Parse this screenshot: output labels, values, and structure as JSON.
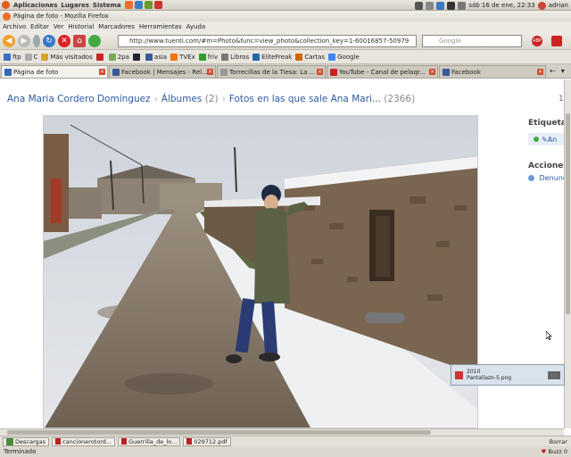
{
  "panel": {
    "menus": [
      "Aplicaciones",
      "Lugares",
      "Sistema"
    ],
    "clock": "sáb 16 de ene, 22:33",
    "user": "adrian"
  },
  "window": {
    "title": "Página de foto - Mozilla Firefox"
  },
  "menubar": [
    "Archivo",
    "Editar",
    "Ver",
    "Historial",
    "Marcadores",
    "Herramientas",
    "Ayuda"
  ],
  "navbar": {
    "url": "http://www.tuenti.com/#m=Photo&func=view_photo&collection_key=1-60016857-50979",
    "search_placeholder": "Google"
  },
  "bookmarks": [
    "ftp",
    "C",
    "Más visitados",
    "2pa",
    "asia",
    "TVEx",
    "friv",
    "Libros",
    "EliteFreak",
    "Cartas",
    "Google"
  ],
  "tabs": [
    {
      "label": "Página de foto"
    },
    {
      "label": "Facebook | Mensajes - Rel..."
    },
    {
      "label": "Torrecillas de la Tiesa: La ..."
    },
    {
      "label": "YouTube - Canal de pelaqr..."
    },
    {
      "label": "Facebook"
    }
  ],
  "page": {
    "breadcrumb": {
      "owner": "Ana Maria Cordero Domínguez",
      "albums": "Álbumes",
      "albums_count": "(2)",
      "current": "Fotos en las que sale Ana Mari...",
      "current_count": "(2366)"
    },
    "page_number": "1",
    "side": {
      "etiquetas": "Etiqueta",
      "tag": "An",
      "acciones": "Acciones",
      "denunciar": "Denunc"
    }
  },
  "download_popup": {
    "year": "2010",
    "filename": "Pantallazo-5.png"
  },
  "downloads": {
    "label": "Descargas",
    "items": [
      "cancionerotord...",
      "Guerrilla_de_lo...",
      "029712.pdf"
    ],
    "clear": "Borrar"
  },
  "status": {
    "text": "Terminado",
    "extra": "Buzz 0"
  }
}
